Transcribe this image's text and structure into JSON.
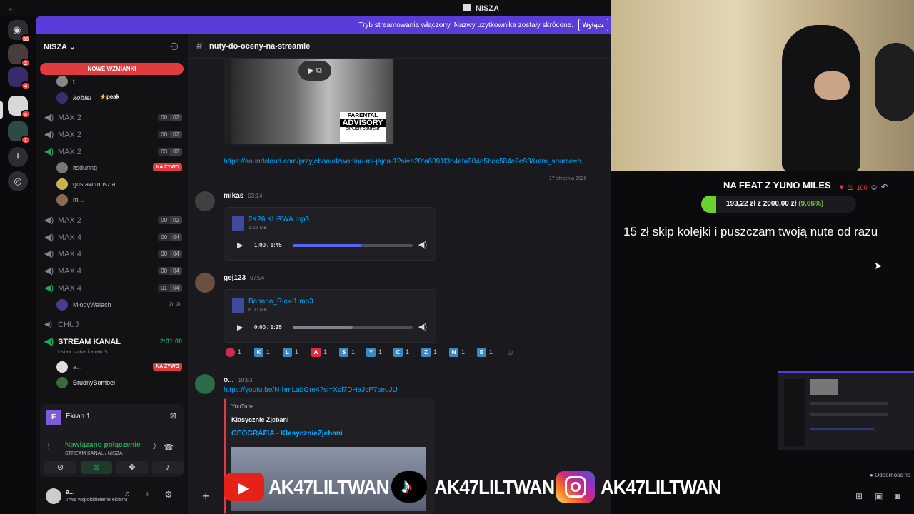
{
  "window": {
    "title": "NISZA",
    "back_icon": "arrow-left-icon"
  },
  "banner": {
    "text": "Tryb streamowania włączony. Nazwy użytkownika zostały skrócone.",
    "button": "Wyłącz"
  },
  "rail": {
    "badges": [
      "36",
      "2",
      "4",
      "8",
      "1"
    ]
  },
  "server": {
    "name": "NISZA"
  },
  "sidebar": {
    "mentions": "NOWE WZMIANKI",
    "users_top": [
      {
        "name": "t"
      },
      {
        "name": "kobiel",
        "status": "peak"
      }
    ],
    "channels": [
      {
        "name": "MAX 2",
        "a": "00",
        "b": "02"
      },
      {
        "name": "MAX 2",
        "a": "00",
        "b": "02"
      },
      {
        "name": "MAX 2",
        "a": "03",
        "b": "02"
      },
      {
        "name": "MAX 2",
        "a": "00",
        "b": "02"
      },
      {
        "name": "MAX 4",
        "a": "00",
        "b": "04"
      },
      {
        "name": "MAX 4",
        "a": "00",
        "b": "04"
      },
      {
        "name": "MAX 4",
        "a": "00",
        "b": "04"
      },
      {
        "name": "MAX 4",
        "a": "01",
        "b": "04"
      }
    ],
    "max2_users": [
      "itsduring",
      "gustaw muszla",
      "m..."
    ],
    "live_label": "NA ŻYWO",
    "max4_user": "MłodyWalach",
    "chuj": "CHUJ",
    "stream": {
      "name": "STREAM KANAŁ",
      "time": "2:31:00",
      "status": "Ustaw status kanału"
    },
    "stream_users": [
      "a...",
      "BrudnyBombel"
    ]
  },
  "screen_panel": {
    "title": "Ekran 1"
  },
  "connection": {
    "status": "Nawiązano połączenie",
    "location": "STREAM KANAŁ / NISZA"
  },
  "user": {
    "name": "a...",
    "status": "Trwa współdzielenie ekranu"
  },
  "chat": {
    "channel": "nuty-do-oceny-na-streamie",
    "parental": [
      "PARENTAL",
      "ADVISORY",
      "EXPLICIT CONTENT"
    ],
    "soundcloud_link": "https://soundcloud.com/przyjebani/dzwoniou-mi-jajca-1?si=a20fa6891f3b4afa904e5bec584e2e93&utm_source=c",
    "date_divider": "17 stycznia 2026",
    "messages": [
      {
        "user": "mikas",
        "time": "03:14",
        "file": "2K26 KURWA.mp3",
        "size": "1.62 MB",
        "player": "1:00 / 1:45",
        "progress": 0.57
      },
      {
        "user": "gej123",
        "time": "07:54",
        "file": "Banana_Rick-1.mp3",
        "size": "8.00 MB",
        "player": "0:00 / 1:25",
        "progress": 0.5
      }
    ],
    "reactions": [
      {
        "letter": "",
        "count": "1",
        "color": "#c9304f"
      },
      {
        "letter": "K",
        "count": "1",
        "color": "#3b88c3"
      },
      {
        "letter": "L",
        "count": "1",
        "color": "#3b88c3"
      },
      {
        "letter": "A",
        "count": "1",
        "color": "#dd2e44"
      },
      {
        "letter": "S",
        "count": "1",
        "color": "#3b88c3"
      },
      {
        "letter": "Y",
        "count": "1",
        "color": "#3b88c3"
      },
      {
        "letter": "C",
        "count": "1",
        "color": "#3b88c3"
      },
      {
        "letter": "Z",
        "count": "1",
        "color": "#3b88c3"
      },
      {
        "letter": "N",
        "count": "1",
        "color": "#3b88c3"
      },
      {
        "letter": "E",
        "count": "1",
        "color": "#3b88c3"
      }
    ],
    "yt_message": {
      "user": "o...",
      "time": "10:53",
      "link": "https://youtu.be/N-hmLabGre4?si=Xpl7DHaJcP7seuJU",
      "provider": "YouTube",
      "author": "Klasycznie Zjebani",
      "title": "GEOGRAFIA - KlasycznieZjebani"
    }
  },
  "overlay": {
    "goal_title": "NA FEAT Z YUNO MILES",
    "goal_text": "193,22 zł z 2000,00 zł",
    "goal_percent": "(9.66%)",
    "goal_fraction": 0.0966,
    "skip": "15 zł skip kolejki i puszczam twoją nute od razu",
    "odpornosc": "Odporność na"
  },
  "socials": [
    {
      "platform": "youtube",
      "name": "AK47LILTWAN"
    },
    {
      "platform": "tiktok",
      "name": "AK47LILTWAN"
    },
    {
      "platform": "instagram",
      "name": "AK47LILTWAN"
    }
  ]
}
